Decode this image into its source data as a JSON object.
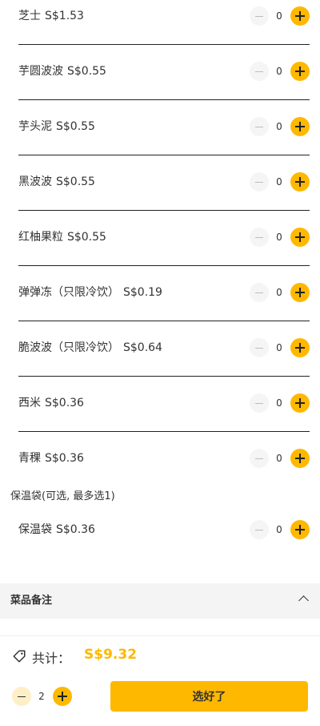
{
  "addons": [
    {
      "name": "芝士",
      "price": "S$1.53",
      "qty": "0"
    },
    {
      "name": "芋圆波波",
      "price": "S$0.55",
      "qty": "0"
    },
    {
      "name": "芋头泥",
      "price": "S$0.55",
      "qty": "0"
    },
    {
      "name": "黑波波",
      "price": "S$0.55",
      "qty": "0"
    },
    {
      "name": "红柚果粒",
      "price": "S$0.55",
      "qty": "0"
    },
    {
      "name": "弹弹冻（只限冷饮）",
      "price": "S$0.19",
      "qty": "0"
    },
    {
      "name": "脆波波（只限冷饮）",
      "price": "S$0.64",
      "qty": "0"
    },
    {
      "name": "西米",
      "price": "S$0.36",
      "qty": "0"
    },
    {
      "name": "青稞",
      "price": "S$0.36",
      "qty": "0"
    }
  ],
  "bag_group": {
    "title": "保温袋(可选, 最多选1)",
    "item": {
      "name": "保温袋",
      "price": "S$0.36",
      "qty": "0"
    }
  },
  "notes": {
    "title": "菜品备注"
  },
  "footer": {
    "total_label": "共计：",
    "total_value": "S$9.32",
    "quantity": "2",
    "confirm_label": "选好了"
  },
  "colors": {
    "accent": "#ffb800"
  }
}
